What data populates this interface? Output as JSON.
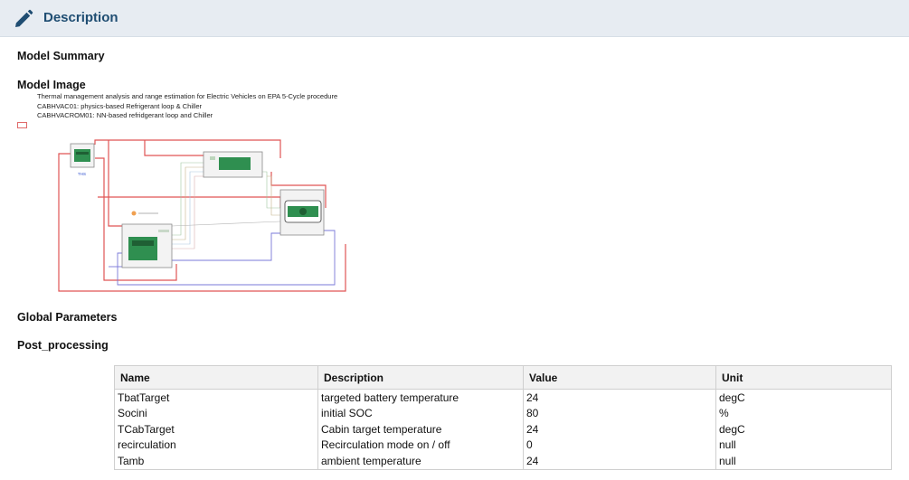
{
  "header": {
    "title": "Description",
    "icon": "pencil-icon"
  },
  "sections": {
    "model_summary": "Model Summary",
    "model_image": "Model Image",
    "global_parameters": "Global Parameters",
    "post_processing": "Post_processing"
  },
  "model_image": {
    "notes": [
      "Thermal management analysis and range estimation for Electric Vehicles on EPA 5-Cycle procedure",
      "CABHVAC01: physics-based Refrigerant loop & Chiller",
      "CABHVACROM01: NN-based refridgerant loop and Chiller"
    ],
    "block_label": "THS"
  },
  "params_table": {
    "headers": [
      "Name",
      "Description",
      "Value",
      "Unit"
    ],
    "rows": [
      [
        "TbatTarget",
        "targeted battery temperature",
        "24",
        "degC"
      ],
      [
        "Socini",
        "initial SOC",
        "80",
        "%"
      ],
      [
        "TCabTarget",
        "Cabin target temperature",
        "24",
        "degC"
      ],
      [
        "recirculation",
        "Recirculation mode on / off",
        "0",
        "null"
      ],
      [
        "Tamb",
        "ambient temperature",
        "24",
        "null"
      ]
    ]
  },
  "colors": {
    "header_bg": "#e7ecf2",
    "title": "#1f4d72",
    "wire_red": "#e05555",
    "wire_blue": "#7070d0"
  }
}
